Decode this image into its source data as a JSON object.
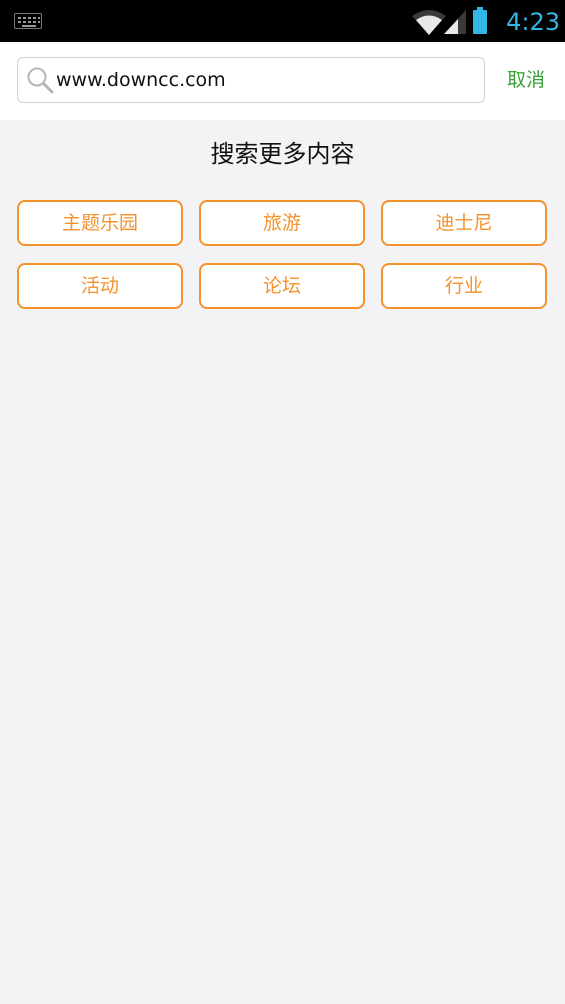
{
  "status_bar": {
    "time": "4:23",
    "icons": [
      "keyboard-icon",
      "wifi-icon",
      "signal-icon",
      "battery-icon"
    ],
    "accent_color": "#33b5e5"
  },
  "search": {
    "value": "www.downcc.com",
    "icon": "search-icon",
    "cancel_label": "取消",
    "cancel_color": "#3aa13a"
  },
  "main": {
    "title": "搜索更多内容",
    "tag_color": "#f5922b",
    "tags": [
      {
        "label": "主题乐园"
      },
      {
        "label": "旅游"
      },
      {
        "label": "迪士尼"
      },
      {
        "label": "活动"
      },
      {
        "label": "论坛"
      },
      {
        "label": "行业"
      }
    ]
  }
}
